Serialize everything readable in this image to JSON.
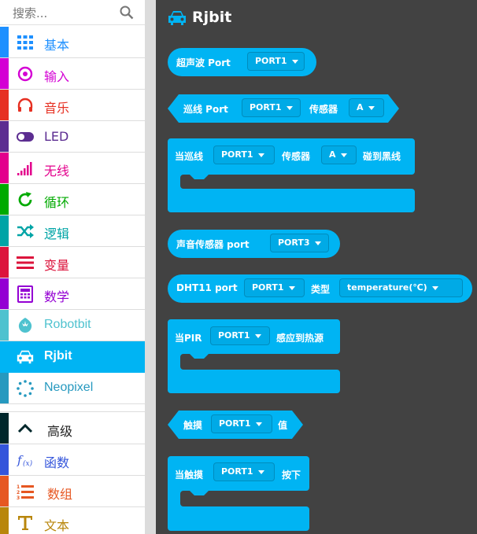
{
  "search": {
    "placeholder": "搜索..."
  },
  "categories": [
    {
      "label": "基本",
      "color": "#1e90ff",
      "icon": "grid-icon"
    },
    {
      "label": "输入",
      "color": "#d400d4",
      "icon": "target-icon"
    },
    {
      "label": "音乐",
      "color": "#e63022",
      "icon": "headphones-icon"
    },
    {
      "label": "LED",
      "color": "#5c2d91",
      "icon": "toggle-icon"
    },
    {
      "label": "无线",
      "color": "#e3008c",
      "icon": "signal-bars-icon"
    },
    {
      "label": "循环",
      "color": "#00aa00",
      "icon": "refresh-icon"
    },
    {
      "label": "逻辑",
      "color": "#00a4a6",
      "icon": "shuffle-icon"
    },
    {
      "label": "变量",
      "color": "#dc143c",
      "icon": "list-lines-icon"
    },
    {
      "label": "数学",
      "color": "#9400d3",
      "icon": "calculator-icon"
    },
    {
      "label": "Robotbit",
      "color": "#4ec2cf",
      "icon": "rebel-icon"
    },
    {
      "label": "Rjbit",
      "color": "#00b4f3",
      "icon": "car-icon"
    },
    {
      "label": "Neopixel",
      "color": "#2699bf",
      "icon": "dots-circle-icon"
    },
    {
      "label": "高级",
      "color": "#00272b",
      "icon": "chevron-up-icon"
    },
    {
      "label": "函数",
      "color": "#3455db",
      "icon": "function-icon"
    },
    {
      "label": "数组",
      "color": "#e65722",
      "icon": "numbered-list-icon"
    },
    {
      "label": "文本",
      "color": "#b8860b",
      "icon": "text-t-icon"
    }
  ],
  "workspace": {
    "title": "Rjbit",
    "bg_color": "#424242",
    "block_color": "#00b4f3"
  },
  "blocks": {
    "ultrasonic": {
      "label": "超声波 Port",
      "port": "PORT1"
    },
    "line": {
      "label": "巡线 Port",
      "port": "PORT1",
      "sensor_label": "传感器",
      "sensor": "A"
    },
    "line_event": {
      "label": "当巡线",
      "port": "PORT1",
      "sensor_label": "传感器",
      "sensor": "A",
      "suffix": "碰到黑线"
    },
    "sound": {
      "label": "声音传感器 port",
      "port": "PORT3"
    },
    "dht11": {
      "label": "DHT11 port",
      "port": "PORT1",
      "type_label": "类型",
      "type": "temperature(℃)"
    },
    "pir": {
      "label": "当PIR",
      "port": "PORT1",
      "suffix": "感应到热源"
    },
    "touch": {
      "label": "触摸",
      "port": "PORT1",
      "suffix": "值"
    },
    "touch_event": {
      "label": "当触摸",
      "port": "PORT1",
      "suffix": "按下"
    }
  }
}
